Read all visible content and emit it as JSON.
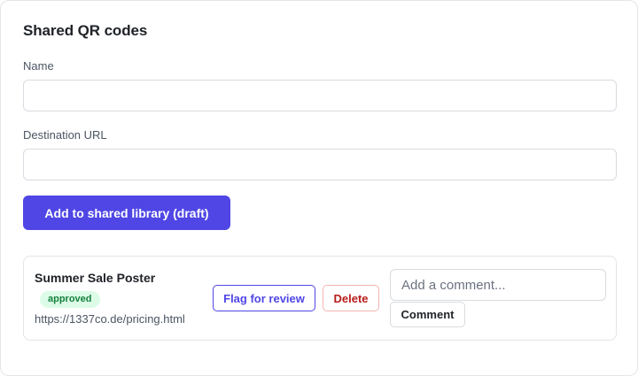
{
  "page": {
    "title": "Shared QR codes"
  },
  "form": {
    "name_label": "Name",
    "name_value": "",
    "url_label": "Destination URL",
    "url_value": "",
    "submit_label": "Add to shared library (draft)"
  },
  "items": [
    {
      "name": "Summer Sale Poster",
      "status": "approved",
      "url": "https://1337co.de/pricing.html",
      "flag_label": "Flag for review",
      "delete_label": "Delete",
      "comment_placeholder": "Add a comment...",
      "comment_label": "Comment"
    }
  ],
  "colors": {
    "accent": "#4f46e5",
    "approved_bg": "#dcfce7",
    "approved_text": "#15803d",
    "danger": "#b91c1c"
  }
}
